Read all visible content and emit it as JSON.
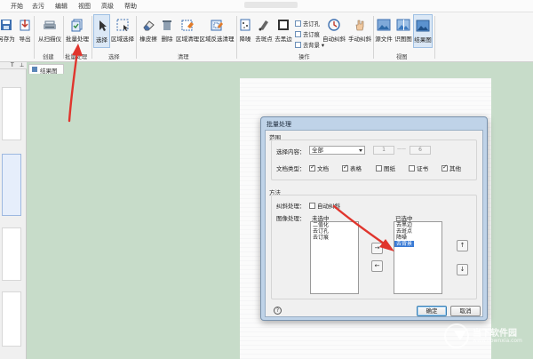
{
  "menubar": {
    "items": [
      "开始",
      "去污",
      "编辑",
      "视图",
      "高级",
      "帮助"
    ]
  },
  "ribbon": {
    "save_as": "另存为",
    "export": "导出",
    "scan": "从扫描仪",
    "batch": "批量处理",
    "select": "选择",
    "area_select": "区域选择",
    "eraser": "橡皮擦",
    "delete": "删除",
    "area_clean": "区域清理",
    "area_reverse_clean": "区域反选清理",
    "despeckle": "降噪",
    "remove_dots": "去斑点",
    "remove_black_edge": "去黑边",
    "remove_binding": "去订孔",
    "remove_staple": "去订痕",
    "remove_bg": "去背景",
    "auto_deskew": "自动纠斜",
    "manual_deskew": "手动纠斜",
    "source_file": "源文件",
    "compare": "识图图",
    "result_view": "结果图",
    "groups": {
      "create": "创建",
      "batch": "批量处理",
      "select": "选择",
      "clean": "清理",
      "operate": "操作",
      "view": "视图"
    }
  },
  "left_panel": {
    "tab": "T"
  },
  "doc_tab": {
    "label": "结果图"
  },
  "dialog": {
    "title": "批量处理",
    "range": {
      "legend": "范围",
      "select_label": "选择内容：",
      "select_value": "全部",
      "from": "1",
      "dash": "——",
      "to": "6",
      "doc_type_label": "文档类型：",
      "types": [
        {
          "label": "文档",
          "checked": true
        },
        {
          "label": "表格",
          "checked": true
        },
        {
          "label": "图纸",
          "checked": false
        },
        {
          "label": "证书",
          "checked": false
        },
        {
          "label": "其他",
          "checked": true
        }
      ]
    },
    "method": {
      "legend": "方法",
      "deskew_label": "纠斜处理：",
      "auto_deskew": "自动纠斜",
      "image_label": "图像处理：",
      "unselected_label": "未选中",
      "selected_label": "已选中",
      "unselected": [
        "二值化",
        "去订孔",
        "去订痕"
      ],
      "selected": [
        "去黑边",
        "去斑点",
        "降噪",
        "去背景"
      ],
      "to_right": "→",
      "to_left": "←",
      "up": "↑",
      "down": "↓"
    },
    "help": "?",
    "ok": "确定",
    "cancel": "取消"
  },
  "watermark": {
    "title": "当下软件园",
    "url": "www.downxia.com"
  },
  "colors": {
    "arrow": "#e0352d",
    "accent": "#3a7bd5",
    "canvas": "#c7dcc9"
  }
}
